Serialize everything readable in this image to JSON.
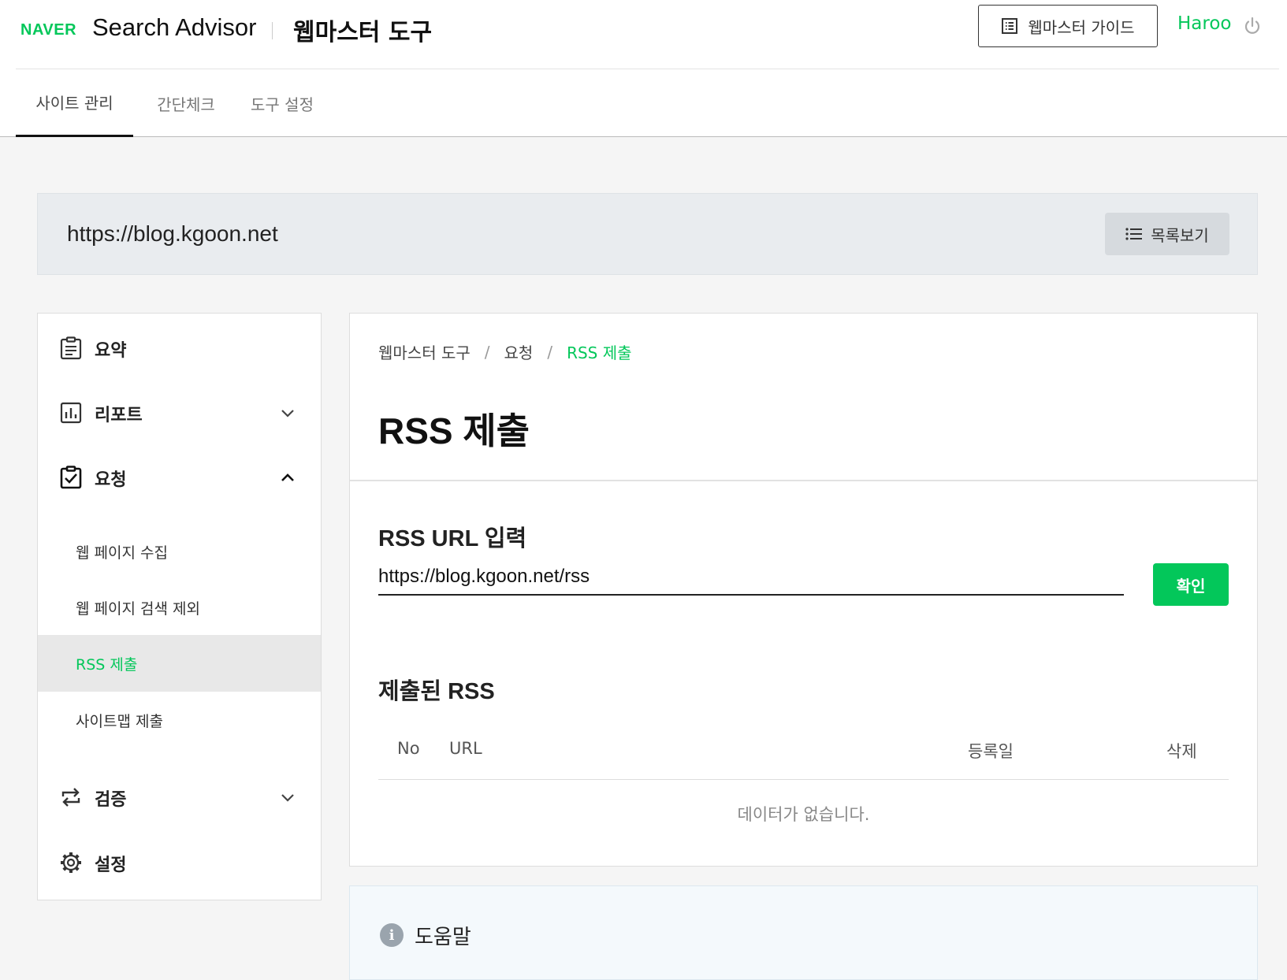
{
  "header": {
    "logo_naver": "NAVER",
    "logo_product": "Search Advisor",
    "logo_tool": "웹마스터 도구",
    "guide_button": "웹마스터 가이드",
    "user_name": "Haroo"
  },
  "tabs": [
    {
      "label": "사이트 관리",
      "active": true
    },
    {
      "label": "간단체크",
      "active": false
    },
    {
      "label": "도구 설정",
      "active": false
    }
  ],
  "site": {
    "url": "https://blog.kgoon.net",
    "list_button": "목록보기"
  },
  "sidebar": {
    "summary": "요약",
    "report": "리포트",
    "request": "요청",
    "sub_items": [
      {
        "label": "웹 페이지 수집",
        "active": false
      },
      {
        "label": "웹 페이지 검색 제외",
        "active": false
      },
      {
        "label": "RSS 제출",
        "active": true
      },
      {
        "label": "사이트맵 제출",
        "active": false
      }
    ],
    "verify": "검증",
    "settings": "설정"
  },
  "main": {
    "breadcrumb": [
      "웹마스터 도구",
      "요청",
      "RSS 제출"
    ],
    "breadcrumb_sep": "/",
    "title": "RSS 제출",
    "input_heading": "RSS URL 입력",
    "input_value": "https://blog.kgoon.net/rss",
    "confirm_button": "확인",
    "submitted_heading": "제출된 RSS",
    "table_headers": {
      "no": "No",
      "url": "URL",
      "date": "등록일",
      "delete": "삭제"
    },
    "empty_message": "데이터가 없습니다."
  },
  "help": {
    "title": "도움말",
    "icon_glyph": "i"
  },
  "colors": {
    "accent": "#03c75a"
  }
}
